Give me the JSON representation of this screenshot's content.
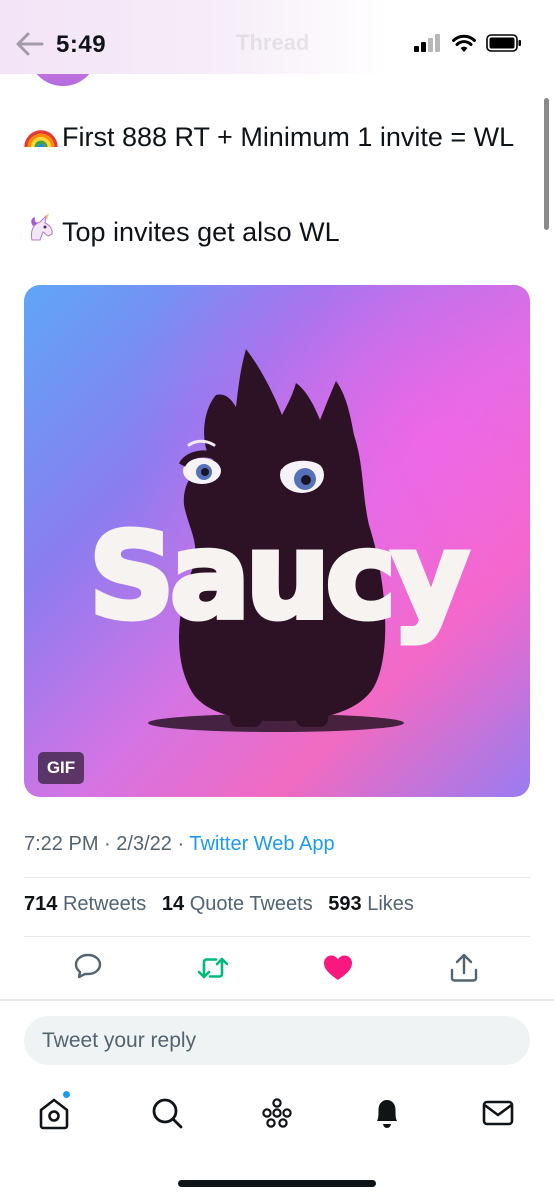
{
  "status_bar": {
    "time": "5:49"
  },
  "nav": {
    "title": "Thread"
  },
  "tweet": {
    "line1": "First 888 RT + Minimum 1 invite = WL",
    "line1_emoji": "rainbow",
    "line2": "Top invites get also WL",
    "line2_emoji": "unicorn",
    "media": {
      "wordmark": "Saucy",
      "badge": "GIF"
    },
    "time": "7:22 PM",
    "date": "2/3/22",
    "separator": "·",
    "source": "Twitter Web App"
  },
  "stats": {
    "retweets_count": "714",
    "retweets_label": "Retweets",
    "quote_count": "14",
    "quote_label": "Quote Tweets",
    "likes_count": "593",
    "likes_label": "Likes"
  },
  "actions": [
    "reply-icon",
    "retweet-icon",
    "like-icon",
    "share-icon"
  ],
  "colors": {
    "retweet": "#00ba7c",
    "like": "#f91880",
    "link": "#1d9bf0"
  },
  "reply": {
    "placeholder": "Tweet your reply"
  },
  "tab_bar": [
    "home-icon",
    "search-icon",
    "spaces-icon",
    "notifications-icon",
    "messages-icon"
  ]
}
